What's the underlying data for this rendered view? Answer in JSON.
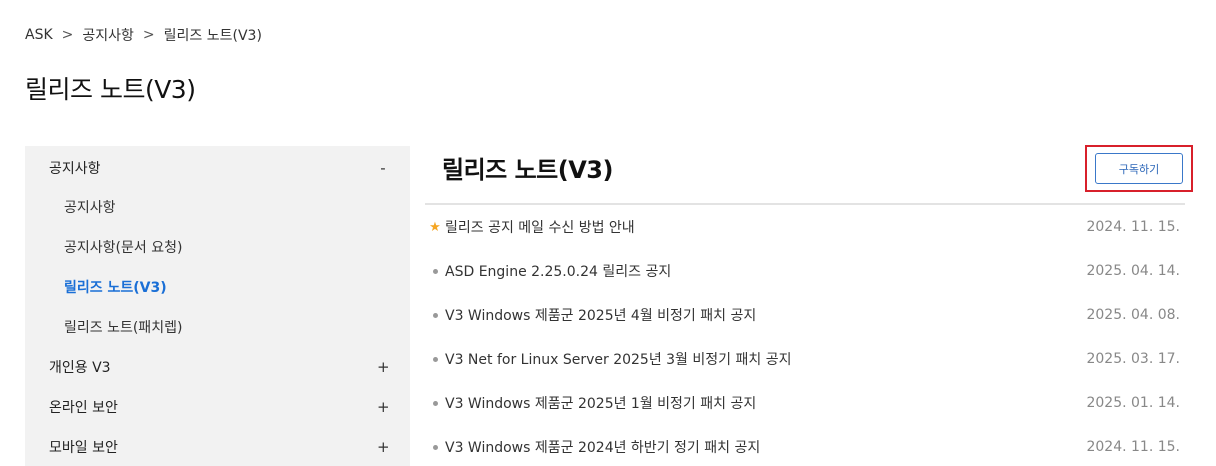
{
  "breadcrumb": {
    "items": [
      "ASK",
      "공지사항",
      "릴리즈 노트(V3)"
    ],
    "separator": ">"
  },
  "page_title": "릴리즈 노트(V3)",
  "sidebar": {
    "sections": [
      {
        "label": "공지사항",
        "toggle": "-"
      },
      {
        "label": "개인용 V3",
        "toggle": "+"
      },
      {
        "label": "온라인 보안",
        "toggle": "+"
      },
      {
        "label": "모바일 보안",
        "toggle": "+"
      }
    ],
    "sub_items": [
      "공지사항",
      "공지사항(문서 요청)",
      "릴리즈 노트(V3)",
      "릴리즈 노트(패치렙)"
    ],
    "active_sub_index": 2
  },
  "main": {
    "title": "릴리즈 노트(V3)",
    "subscribe_label": "구독하기",
    "notices": [
      {
        "title": "릴리즈 공지 메일 수신 방법 안내",
        "date": "2024. 11. 15.",
        "icon": "star-icon"
      },
      {
        "title": "ASD Engine 2.25.0.24 릴리즈 공지",
        "date": "2025. 04. 14.",
        "icon": "dot"
      },
      {
        "title": "V3 Windows 제품군 2025년 4월 비정기 패치 공지",
        "date": "2025. 04. 08.",
        "icon": "dot"
      },
      {
        "title": "V3 Net for Linux Server 2025년 3월 비정기 패치 공지",
        "date": "2025. 03. 17.",
        "icon": "dot"
      },
      {
        "title": "V3 Windows 제품군 2025년 1월 비정기 패치 공지",
        "date": "2025. 01. 14.",
        "icon": "dot"
      },
      {
        "title": "V3 Windows 제품군 2024년 하반기 정기 패치 공지",
        "date": "2024. 11. 15.",
        "icon": "dot"
      }
    ]
  },
  "colors": {
    "accent": "#1a6fd6",
    "highlight_border": "#d8202b",
    "star": "#f5a623",
    "sidebar_bg": "#f2f2f2"
  }
}
